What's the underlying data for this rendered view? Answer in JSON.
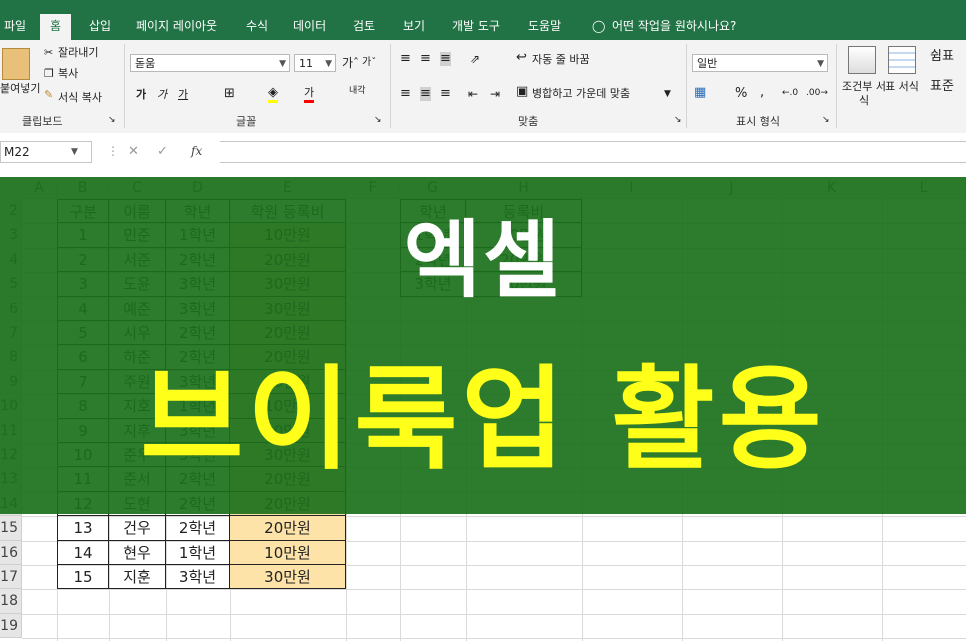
{
  "app": {
    "accent_color": "#217346",
    "overlay_color": "#1b701b",
    "title_color": "#ffff1a"
  },
  "menu": {
    "tabs": [
      "파일",
      "홈",
      "삽입",
      "페이지 레이아웃",
      "수식",
      "데이터",
      "검토",
      "보기",
      "개발 도구",
      "도움말"
    ],
    "tell_me": "어떤 작업을 원하시나요?"
  },
  "ribbon": {
    "clipboard": {
      "cut": "잘라내기",
      "copy": "복사",
      "paste": "붙여넣기",
      "format_painter": "서식 복사",
      "label": "클립보드"
    },
    "font": {
      "name": "돋움",
      "size": "11",
      "label": "글꼴"
    },
    "alignment": {
      "wrap": "자동 줄 바꿈",
      "merge": "병합하고 가운데 맞춤",
      "label": "맞춤"
    },
    "number": {
      "format": "일반",
      "percent": "%",
      "label": "표시 형식"
    },
    "styles": {
      "conditional": "조건부 서식",
      "table": "표 서식",
      "cell_style_1": "쉼표",
      "cell_style_2": "표준"
    }
  },
  "formula_bar": {
    "name_box": "M22",
    "fx": "fx",
    "value": ""
  },
  "sheet": {
    "columns": [
      "A",
      "B",
      "C",
      "D",
      "E",
      "F",
      "G",
      "H",
      "I",
      "J",
      "K",
      "L"
    ],
    "rows": [
      "2",
      "3",
      "4",
      "5",
      "6",
      "7",
      "8",
      "9",
      "10",
      "11",
      "12",
      "13",
      "14",
      "15",
      "16",
      "17",
      "18",
      "19"
    ],
    "table_headers": [
      "구분",
      "이름",
      "학년",
      "학원 등록비"
    ],
    "table_rows": [
      [
        "1",
        "민준",
        "1학년",
        "10만원"
      ],
      [
        "2",
        "서준",
        "2학년",
        "20만원"
      ],
      [
        "3",
        "도윤",
        "3학년",
        "30만원"
      ],
      [
        "4",
        "예준",
        "3학년",
        "30만원"
      ],
      [
        "5",
        "시우",
        "2학년",
        "20만원"
      ],
      [
        "6",
        "하준",
        "2학년",
        "20만원"
      ],
      [
        "7",
        "주원",
        "3학년",
        "30만원"
      ],
      [
        "8",
        "지호",
        "1학년",
        "10만원"
      ],
      [
        "9",
        "지후",
        "3학년",
        "30만원"
      ],
      [
        "10",
        "준우",
        "3학년",
        "30만원"
      ],
      [
        "11",
        "준서",
        "2학년",
        "20만원"
      ],
      [
        "12",
        "도현",
        "2학년",
        "20만원"
      ],
      [
        "13",
        "건우",
        "2학년",
        "20만원"
      ],
      [
        "14",
        "현우",
        "1학년",
        "10만원"
      ],
      [
        "15",
        "지훈",
        "3학년",
        "30만원"
      ]
    ],
    "lookup_headers": [
      "학년",
      "등록비"
    ],
    "lookup_rows": [
      [
        "1학년",
        "10만원"
      ],
      [
        "2학년",
        "20만원"
      ],
      [
        "3학년",
        "30만원"
      ]
    ]
  },
  "banner": {
    "line1": "엑셀",
    "line2": "브이룩업 활용"
  }
}
